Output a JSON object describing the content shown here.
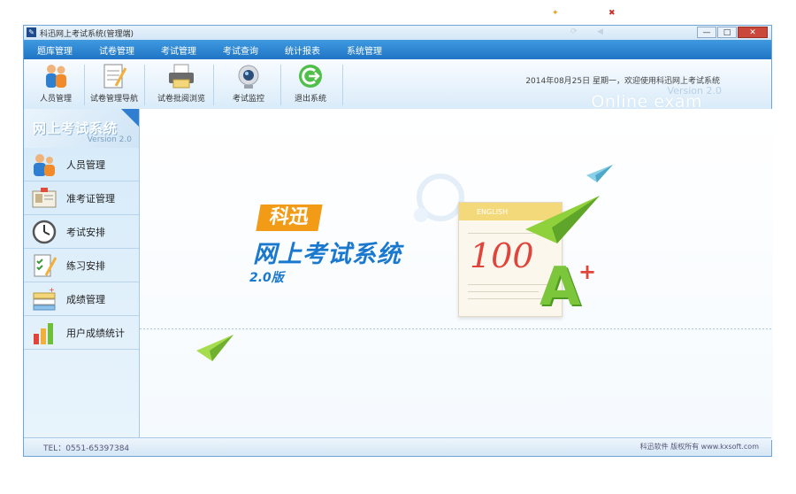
{
  "window": {
    "title": "科迅网上考试系统(管理端)"
  },
  "menubar": {
    "items": [
      "题库管理",
      "试卷管理",
      "考试管理",
      "考试查询",
      "统计报表",
      "系统管理"
    ]
  },
  "toolbar": {
    "buttons": [
      {
        "label": "人员管理",
        "icon": "people-icon"
      },
      {
        "label": "试卷管理导航",
        "icon": "exam-paper-icon"
      },
      {
        "label": "试卷批阅浏览",
        "icon": "printer-icon"
      },
      {
        "label": "考试监控",
        "icon": "camera-icon"
      },
      {
        "label": "退出系统",
        "icon": "exit-icon"
      }
    ],
    "greeting": "2014年08月25日 星期一，欢迎使用科迅网上考试系统",
    "version": "Version 2.0",
    "online_text": "Online exam"
  },
  "sidebar": {
    "logo": "网上考试系统",
    "version": "Version 2.0",
    "items": [
      {
        "label": "人员管理",
        "icon": "users-icon"
      },
      {
        "label": "准考证管理",
        "icon": "id-card-icon"
      },
      {
        "label": "考试安排",
        "icon": "clock-icon"
      },
      {
        "label": "练习安排",
        "icon": "checklist-icon"
      },
      {
        "label": "成绩管理",
        "icon": "score-icon"
      },
      {
        "label": "用户成绩统计",
        "icon": "bar-chart-icon"
      }
    ]
  },
  "banner": {
    "brand": "科迅",
    "product": "网上考试系统",
    "version": "2.0版",
    "paper_header": "ENGLISH",
    "score": "100",
    "grade": "A",
    "grade_plus": "+"
  },
  "statusbar": {
    "tel": "TEL：0551-65397384",
    "right": "科迅软件 版权所有 www.kxsoft.com"
  },
  "colors": {
    "menubar": "#2a86d6",
    "accent": "#1a79cf",
    "brand_orange": "#f29b16",
    "score_red": "#e0443a",
    "plane_green": "#8fd13a"
  }
}
